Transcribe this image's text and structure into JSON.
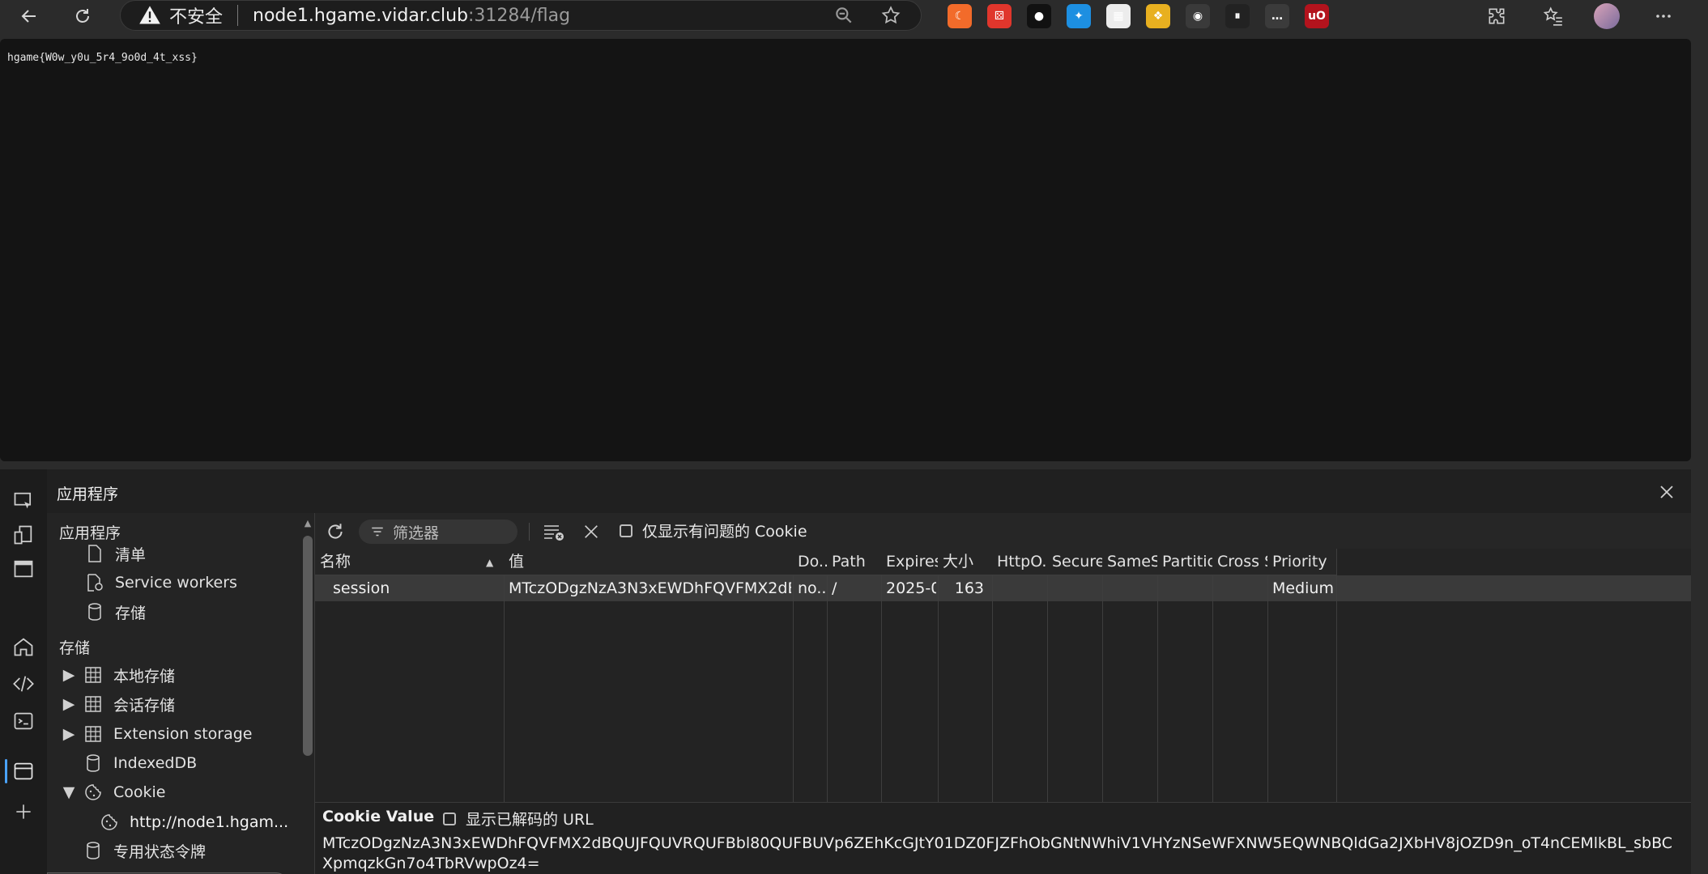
{
  "browser": {
    "insecure_label": "不安全",
    "url_host": "node1.hgame.vidar.club",
    "url_rest": ":31284/flag",
    "extensions": [
      {
        "name": "dark-reader-icon",
        "color": "#f26b2a",
        "glyph": "☾"
      },
      {
        "name": "dice-extension-icon",
        "color": "#e0362c",
        "glyph": "⚄"
      },
      {
        "name": "circle-extension-icon",
        "color": "#111111",
        "glyph": "●"
      },
      {
        "name": "bird-extension-icon",
        "color": "#1d8fe1",
        "glyph": "✦"
      },
      {
        "name": "qr-code-icon",
        "color": "#ececec",
        "glyph": "▦"
      },
      {
        "name": "cat-extension-icon",
        "color": "#e8b020",
        "glyph": "❖"
      },
      {
        "name": "tampermonkey-icon",
        "color": "#3a3a3a",
        "glyph": "◉"
      },
      {
        "name": "pause-extension-icon",
        "color": "#222222",
        "glyph": "⏸"
      },
      {
        "name": "chat-extension-icon",
        "color": "#3b3b3b",
        "glyph": "…"
      },
      {
        "name": "ublock-origin-icon",
        "color": "#b3131d",
        "glyph": "uO"
      }
    ]
  },
  "page": {
    "flag_text": "hgame{W0w_y0u_5r4_9o0d_4t_xss}"
  },
  "devtools": {
    "title": "应用程序",
    "tree": {
      "section_app": "应用程序",
      "app_items": [
        "清单",
        "Service workers",
        "存储"
      ],
      "section_storage": "存储",
      "storage_items": [
        "本地存储",
        "会话存储",
        "Extension storage",
        "IndexedDB",
        "Cookie"
      ],
      "cookie_child": "http://node1.hgam...",
      "cut_off_item": "专用状态令牌"
    },
    "toolbar": {
      "filter_placeholder": "筛选器",
      "only_issues_label": "仅显示有问题的 Cookie"
    },
    "grid": {
      "headers": [
        "名称",
        "值",
        "Do...",
        "Path",
        "Expires...",
        "大小",
        "HttpO...",
        "Secure",
        "SameSi...",
        "Partitio...",
        "Cross S...",
        "Priority"
      ],
      "row": {
        "name": "session",
        "value": "MTczODgzNzA3N3xEWDhFQVFMX2dBQUJFQUVRQ...",
        "domain": "no...",
        "path": "/",
        "expires": "2025-0...",
        "size": "163",
        "priority": "Medium"
      }
    },
    "cookie_value": {
      "title": "Cookie Value",
      "decode_label": "显示已解码的 URL",
      "value": "MTczODgzNzA3N3xEWDhFQVFMX2dBQUJFQUVRQUFBbl80QUFBUVp6ZEhKcGJtY01DZ0FJZFhObGNtNWhiV1VHYzNSeWFXNW5EQWNBQldGa2JXbHV8jOZD9n_oT4nCEMlkBL_sbBCXpmqzkGn7o4TbRVwpOz4="
    }
  }
}
